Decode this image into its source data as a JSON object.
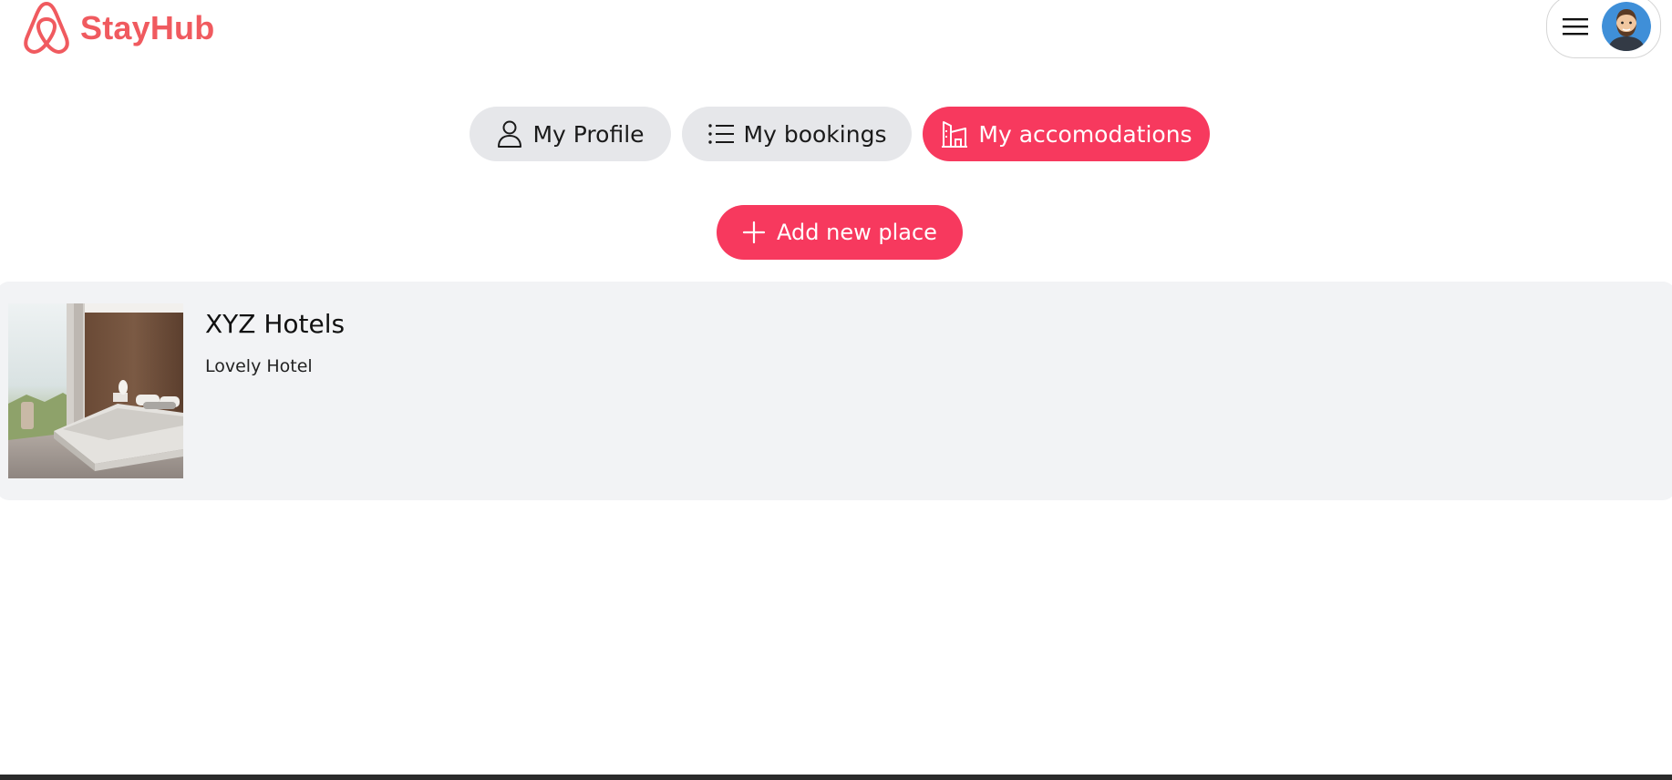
{
  "app": {
    "name": "StayHub",
    "brand_color": "#f05a5f",
    "accent_color": "#f7395e"
  },
  "header": {
    "logo_icon": "airbnb-logo-icon",
    "menu_icon": "hamburger-menu-icon",
    "avatar_icon": "user-avatar-icon"
  },
  "tabs": [
    {
      "label": "My Profile",
      "icon": "user-icon",
      "active": false
    },
    {
      "label": "My bookings",
      "icon": "list-icon",
      "active": false
    },
    {
      "label": "My accomodations",
      "icon": "building-icon",
      "active": true
    }
  ],
  "actions": {
    "add_label": "Add new place",
    "add_icon": "plus-icon"
  },
  "places": [
    {
      "title": "XYZ Hotels",
      "description": "Lovely Hotel",
      "photo": "hotel-room-photo"
    }
  ]
}
